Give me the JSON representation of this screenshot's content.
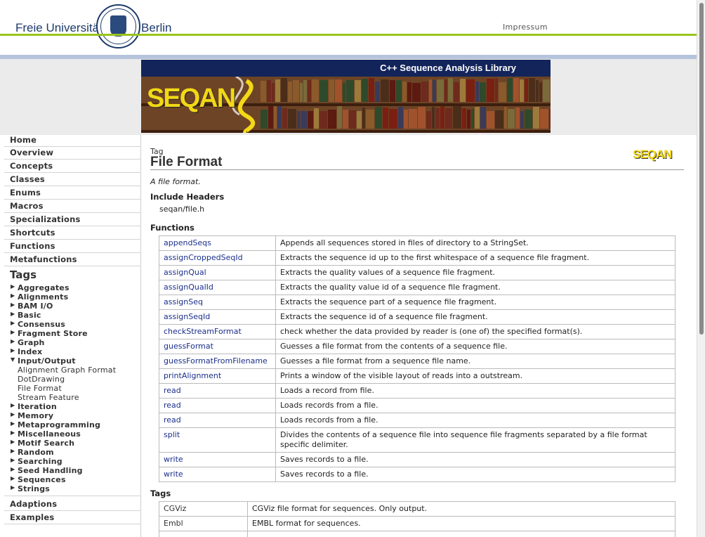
{
  "header": {
    "university_left": "Freie Universität",
    "university_right": "Berlin",
    "impressum": "Impressum"
  },
  "banner": {
    "title": "C++ Sequence Analysis Library",
    "logo_text": "SEQAN"
  },
  "nav": {
    "items": [
      "Home",
      "Overview",
      "Concepts",
      "Classes",
      "Enums",
      "Macros",
      "Specializations",
      "Shortcuts",
      "Functions",
      "Metafunctions"
    ],
    "tags_heading": "Tags",
    "tags": [
      {
        "label": "Aggregates",
        "expanded": false
      },
      {
        "label": "Alignments",
        "expanded": false
      },
      {
        "label": "BAM I/O",
        "expanded": false
      },
      {
        "label": "Basic",
        "expanded": false
      },
      {
        "label": "Consensus",
        "expanded": false
      },
      {
        "label": "Fragment Store",
        "expanded": false
      },
      {
        "label": "Graph",
        "expanded": false
      },
      {
        "label": "Index",
        "expanded": false
      },
      {
        "label": "Input/Output",
        "expanded": true
      },
      {
        "label": "Iteration",
        "expanded": false
      },
      {
        "label": "Memory",
        "expanded": false
      },
      {
        "label": "Metaprogramming",
        "expanded": false
      },
      {
        "label": "Miscellaneous",
        "expanded": false
      },
      {
        "label": "Motif Search",
        "expanded": false
      },
      {
        "label": "Random",
        "expanded": false
      },
      {
        "label": "Searching",
        "expanded": false
      },
      {
        "label": "Seed Handling",
        "expanded": false
      },
      {
        "label": "Sequences",
        "expanded": false
      },
      {
        "label": "Strings",
        "expanded": false
      }
    ],
    "io_subitems": [
      "Alignment Graph Format",
      "DotDrawing",
      "File Format",
      "Stream Feature"
    ],
    "bottom_items": [
      "Adaptions",
      "Examples"
    ]
  },
  "content": {
    "kind": "Tag",
    "title": "File Format",
    "logo_text": "SEQAN",
    "summary": "A file format.",
    "include_heading": "Include Headers",
    "include_file": "seqan/file.h",
    "functions_heading": "Functions",
    "functions": [
      {
        "name": "appendSeqs",
        "desc": "Appends all sequences stored in files of directory to a StringSet."
      },
      {
        "name": "assignCroppedSeqId",
        "desc": "Extracts the sequence id up to the first whitespace of a sequence file fragment."
      },
      {
        "name": "assignQual",
        "desc": "Extracts the quality values of a sequence file fragment."
      },
      {
        "name": "assignQualId",
        "desc": "Extracts the quality value id of a sequence file fragment."
      },
      {
        "name": "assignSeq",
        "desc": "Extracts the sequence part of a sequence file fragment."
      },
      {
        "name": "assignSeqId",
        "desc": "Extracts the sequence id of a sequence file fragment."
      },
      {
        "name": "checkStreamFormat",
        "desc": "check whether the data provided by reader is (one of) the specified format(s)."
      },
      {
        "name": "guessFormat",
        "desc": "Guesses a file format from the contents of a sequence file."
      },
      {
        "name": "guessFormatFromFilename",
        "desc": "Guesses a file format from a sequence file name."
      },
      {
        "name": "printAlignment",
        "desc": "Prints a window of the visible layout of reads into a outstream."
      },
      {
        "name": "read",
        "desc": "Loads a record from file."
      },
      {
        "name": "read",
        "desc": "Loads records from a file."
      },
      {
        "name": "read",
        "desc": "Loads records from a file."
      },
      {
        "name": "split",
        "desc": "Divides the contents of a sequence file into sequence file fragments separated by a file format specific delimiter."
      },
      {
        "name": "write",
        "desc": "Saves records to a file."
      },
      {
        "name": "write",
        "desc": "Saves records to a file."
      }
    ],
    "tags_heading": "Tags",
    "tags": [
      {
        "name": "CGViz",
        "desc": "CGViz file format for sequences. Only output."
      },
      {
        "name": "Embl",
        "desc": "EMBL format for sequences."
      },
      {
        "name": "",
        "desc": ""
      }
    ]
  }
}
